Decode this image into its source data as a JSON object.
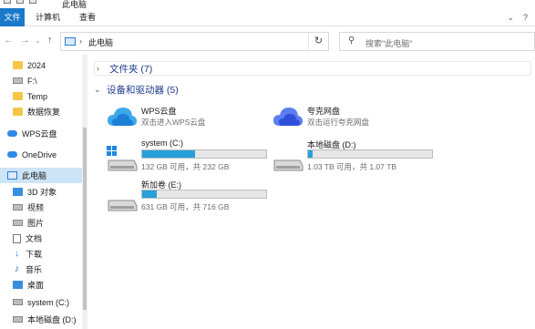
{
  "window": {
    "title": "此电脑"
  },
  "ribbon": {
    "tabs": [
      "文件",
      "计算机",
      "查看"
    ]
  },
  "address": {
    "path": "此电脑"
  },
  "search": {
    "placeholder": "搜索\"此电脑\""
  },
  "sidebar": {
    "items": [
      {
        "label": "2024",
        "icon": "folder-icon"
      },
      {
        "label": "F:\\",
        "icon": "drive-icon"
      },
      {
        "label": "Temp",
        "icon": "folder-icon"
      },
      {
        "label": "数据恢复",
        "icon": "folder-icon"
      },
      {
        "label": "WPS云盘",
        "icon": "cloud-icon"
      },
      {
        "label": "OneDrive",
        "icon": "cloud-icon"
      },
      {
        "label": "此电脑",
        "icon": "computer-icon"
      },
      {
        "label": "3D 对象",
        "icon": "cube-icon"
      },
      {
        "label": "视频",
        "icon": "video-icon"
      },
      {
        "label": "图片",
        "icon": "picture-icon"
      },
      {
        "label": "文档",
        "icon": "document-icon"
      },
      {
        "label": "下载",
        "icon": "download-icon"
      },
      {
        "label": "音乐",
        "icon": "music-icon"
      },
      {
        "label": "桌面",
        "icon": "desktop-icon"
      },
      {
        "label": "system (C:)",
        "icon": "drive-icon"
      },
      {
        "label": "本地磁盘 (D:)",
        "icon": "drive-icon"
      }
    ]
  },
  "content": {
    "groups": {
      "folders": "文件夹 (7)",
      "devices": "设备和驱动器 (5)"
    },
    "clouds": [
      {
        "name": "WPS云盘",
        "subtitle": "双击进入WPS云盘"
      },
      {
        "name": "夸克网盘",
        "subtitle": "双击运行夸克网盘"
      }
    ],
    "drives": [
      {
        "name": "system (C:)",
        "size": "132 GB 可用，共 232 GB",
        "used_fraction": 0.43
      },
      {
        "name": "本地磁盘 (D:)",
        "size": "1.03 TB 可用，共 1.07 TB",
        "used_fraction": 0.04
      },
      {
        "name": "新加卷 (E:)",
        "size": "631 GB 可用，共 716 GB",
        "used_fraction": 0.12
      }
    ]
  },
  "colors": {
    "accent": "#1979ca",
    "usage_bar": "#26a0da",
    "selection": "#cce4f7",
    "group_heading": "#1e3c8c"
  }
}
